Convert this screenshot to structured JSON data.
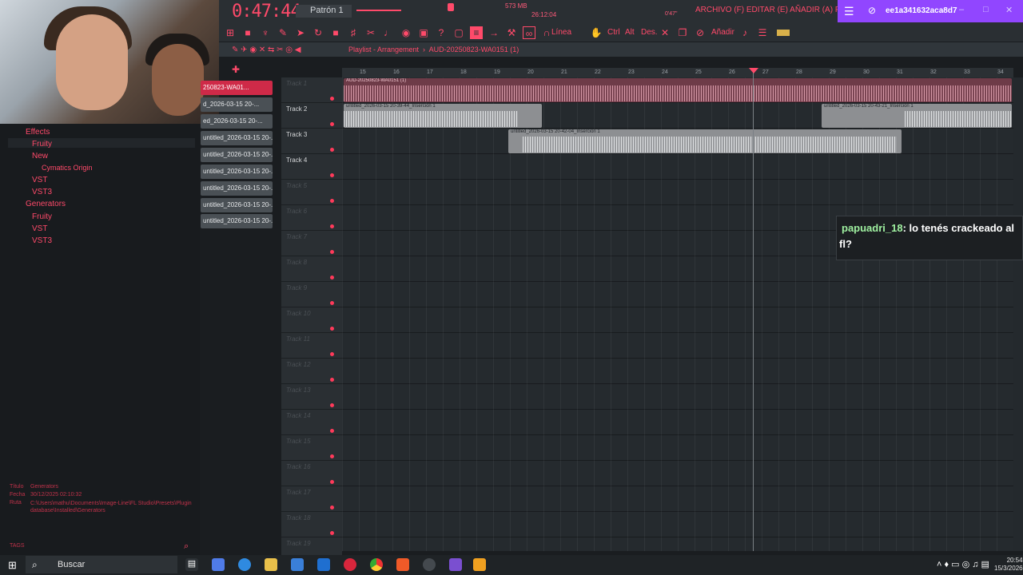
{
  "transport": {
    "time": "0:47:44",
    "pattern": "Patrón 1",
    "cpu": "573 MB",
    "timecode": "26:12:04",
    "position_label": "0'47\""
  },
  "menu_text": "ARCHIVO (F) EDITAR (E) AÑADIR (A) PATRONES (P) V",
  "toolbar": {
    "linea_label": "Línea",
    "ctrl_label": "Ctrl",
    "alt_label": "Alt",
    "des_label": "Des.",
    "anadir_label": "Añadir"
  },
  "twitch": {
    "title": "ee1a341632aca8d7"
  },
  "playlist": {
    "title": "Playlist - Arrangement",
    "pattern": "AUD-20250823-WA0151 (1)"
  },
  "browser": {
    "items": [
      {
        "label": "Effects"
      },
      {
        "label": "Fruity"
      },
      {
        "label": "New"
      },
      {
        "label": "Cymatics Origin"
      },
      {
        "label": "VST"
      },
      {
        "label": "VST3"
      },
      {
        "label": "Generators"
      },
      {
        "label": "Fruity"
      },
      {
        "label": "VST"
      },
      {
        "label": "VST3"
      }
    ],
    "info": {
      "title_label": "Título",
      "title_value": "Generators",
      "date_label": "Fecha",
      "date_value": "30/12/2025 02:10:32",
      "path_label": "Ruta",
      "path_value": "C:\\Users\\mathu\\Documents\\Image-Line\\FL Studio\\Presets\\Plugin database\\Installed\\Generators",
      "tags_label": "TAGS"
    }
  },
  "channels": [
    "250823-WA01...",
    "d_2026-03-15 20-...",
    "ed_2026-03-15 20-...",
    "untitled_2026-03-15 20-...",
    "untitled_2026-03-15 20-...",
    "untitled_2026-03-15 20-...",
    "untitled_2026-03-15 20-...",
    "untitled_2026-03-15 20-...",
    "untitled_2026-03-15 20-..."
  ],
  "tracks": [
    "Track 1",
    "Track 2",
    "Track 3",
    "Track 4",
    "Track 5",
    "Track 6",
    "Track 7",
    "Track 8",
    "Track 9",
    "Track 10",
    "Track 11",
    "Track 12",
    "Track 13",
    "Track 14",
    "Track 15",
    "Track 16",
    "Track 17",
    "Track 18",
    "Track 19"
  ],
  "ruler": [
    "15",
    "16",
    "17",
    "18",
    "19",
    "20",
    "21",
    "22",
    "23",
    "24",
    "25",
    "26",
    "27",
    "28",
    "29",
    "30",
    "31",
    "32",
    "33",
    "34"
  ],
  "clips": {
    "c1": "AUD-20250823-WA0151 (1)",
    "c2": "untitled_2026-03-15 20-39-44_Inserción 1",
    "c3": "untitled_2026-03-15 20-42-04_Inserción 1",
    "c4": "untitled_2026-03-15 20-43-21_Inserción 1"
  },
  "chat": {
    "user": "papuadri_18",
    "message": ": lo tenés crackeado al",
    "message2": "fl?"
  },
  "taskbar": {
    "search": "Buscar",
    "time": "20:54",
    "date": "15/3/2026"
  }
}
